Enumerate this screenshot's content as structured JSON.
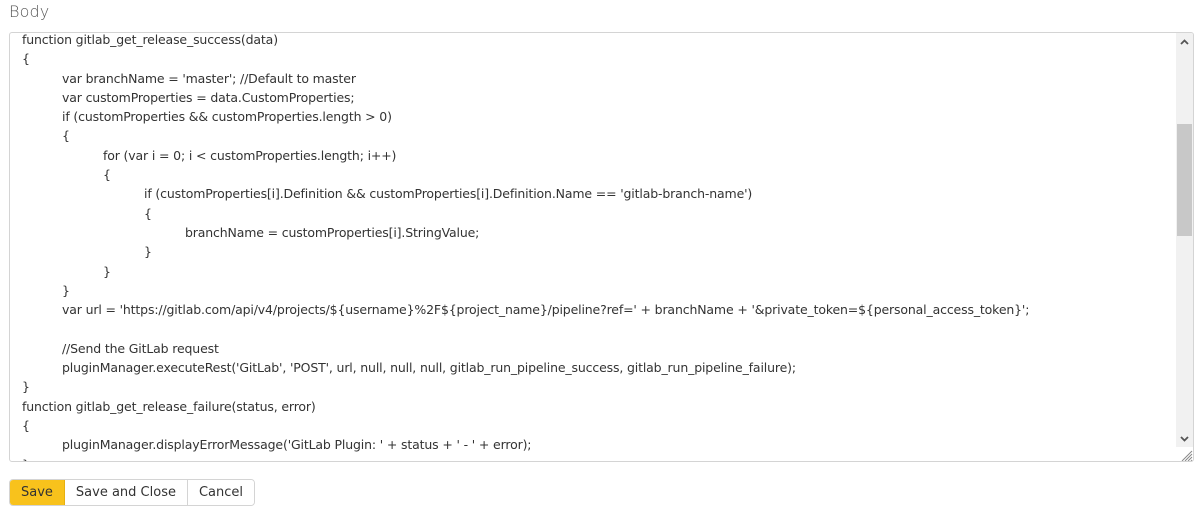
{
  "field": {
    "label": "Body"
  },
  "editor": {
    "lines": [
      {
        "indent": 0,
        "text": "function gitlab_get_release_success(data)"
      },
      {
        "indent": 0,
        "text": "{"
      },
      {
        "indent": 1,
        "text": "var branchName = 'master'; //Default to master"
      },
      {
        "indent": 1,
        "text": "var customProperties = data.CustomProperties;"
      },
      {
        "indent": 1,
        "text": "if (customProperties && customProperties.length > 0)"
      },
      {
        "indent": 1,
        "text": "{"
      },
      {
        "indent": 2,
        "text": "for (var i = 0; i < customProperties.length; i++)"
      },
      {
        "indent": 2,
        "text": "{"
      },
      {
        "indent": 3,
        "text": "if (customProperties[i].Definition && customProperties[i].Definition.Name == 'gitlab-branch-name')"
      },
      {
        "indent": 3,
        "text": "{"
      },
      {
        "indent": 4,
        "text": "branchName = customProperties[i].StringValue;"
      },
      {
        "indent": 3,
        "text": "}"
      },
      {
        "indent": 2,
        "text": "}"
      },
      {
        "indent": 1,
        "text": "}"
      },
      {
        "indent": 1,
        "text": "var url = 'https://gitlab.com/api/v4/projects/${username}%2F${project_name}/pipeline?ref=' + branchName + '&private_token=${personal_access_token}';"
      },
      {
        "indent": 1,
        "text": ""
      },
      {
        "indent": 1,
        "text": "//Send the GitLab request"
      },
      {
        "indent": 1,
        "text": "pluginManager.executeRest('GitLab', 'POST', url, null, null, null, gitlab_run_pipeline_success, gitlab_run_pipeline_failure);"
      },
      {
        "indent": 0,
        "text": "}"
      },
      {
        "indent": 0,
        "text": "function gitlab_get_release_failure(status, error)"
      },
      {
        "indent": 0,
        "text": "{"
      },
      {
        "indent": 1,
        "text": "pluginManager.displayErrorMessage('GitLab Plugin: ' + status + ' - ' + error);"
      },
      {
        "indent": 0,
        "text": "}"
      }
    ],
    "scrollbar": {
      "up_icon": "chevron-up-icon",
      "down_icon": "chevron-down-icon",
      "scroll_position_fraction": 0.3
    },
    "resize_icon": "resize-grip-icon"
  },
  "buttons": {
    "save_label": "Save",
    "save_and_close_label": "Save and Close",
    "cancel_label": "Cancel"
  },
  "colors": {
    "primary_button": "#f8c21c",
    "border": "#d4d4d4",
    "text": "#333333"
  }
}
